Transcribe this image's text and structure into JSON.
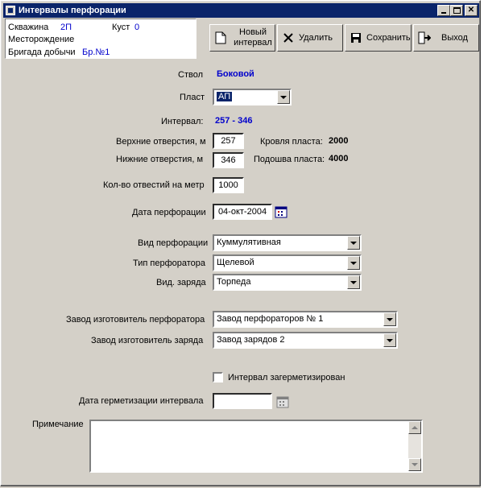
{
  "window": {
    "title": "Интервалы перфорации",
    "controls": [
      "_",
      "□",
      "×"
    ]
  },
  "info": {
    "well_label": "Скважина",
    "well_value": "2П",
    "cluster_label": "Куст",
    "cluster_value": "0",
    "field_label": "Месторождение",
    "brigade_label": "Бригада добычи",
    "brigade_value": "Бр.№1"
  },
  "toolbar": {
    "new_label_line1": "Новый",
    "new_label_line2": "интервал",
    "delete_label": "Удалить",
    "save_label": "Сохранить",
    "exit_label": "Выход"
  },
  "form": {
    "trunk_label": "Ствол",
    "trunk_value": "Боковой",
    "layer_label": "Пласт",
    "layer_value": "АП",
    "interval_label": "Интервал:",
    "interval_value": "257 - 346",
    "upper_label": "Верхние отверстия, м",
    "upper_value": "257",
    "roof_label": "Кровля пласта:",
    "roof_value": "2000",
    "lower_label": "Нижние отверстия, м",
    "lower_value": "346",
    "sole_label": "Подошва пласта:",
    "sole_value": "4000",
    "holes_label": "Кол-во отвестий на метр",
    "holes_value": "1000",
    "date_label": "Дата перфорации",
    "date_value": "04-окт-2004",
    "perf_type_label": "Вид перфорации",
    "perf_type_value": "Куммулятивная",
    "perforator_type_label": "Тип перфоратора",
    "perforator_type_value": "Щелевой",
    "charge_type_label": "Вид. заряда",
    "charge_type_value": "Торпеда",
    "perforator_maker_label": "Завод изготовитель перфоратора",
    "perforator_maker_value": "Завод перфораторов № 1",
    "charge_maker_label": "Завод изготовитель заряда",
    "charge_maker_value": "Завод зарядов 2",
    "sealed_label": "Интервал загерметизирован",
    "seal_date_label": "Дата герметизации интервала",
    "seal_date_value": "",
    "note_label": "Примечание",
    "note_value": ""
  },
  "colors": {
    "titlebar": "#0a246a",
    "accent_text": "#0000cc",
    "face": "#d4d0c8"
  }
}
